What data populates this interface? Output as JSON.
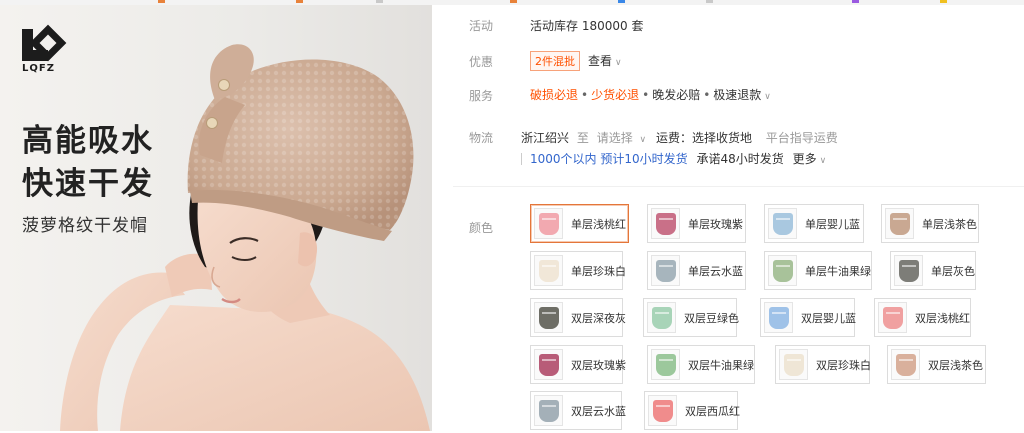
{
  "top_strip_colors": [
    "#e8823a",
    "#e8823a",
    "#c9c9c9",
    "#e8823a",
    "#3a88e8",
    "#c9c9c9",
    "#9a5ae0",
    "#f0c020"
  ],
  "hero": {
    "logo_text": "LQFZ",
    "headline_line1": "高能吸水",
    "headline_line2": "快速干发",
    "subheadline": "菠萝格纹干发帽"
  },
  "details": {
    "activity": {
      "label": "活动",
      "value": "活动库存 180000 套"
    },
    "discount": {
      "label": "优惠",
      "tag": "2件混批",
      "view": "查看"
    },
    "service": {
      "label": "服务",
      "items": [
        "破损必退",
        "少货必退",
        "晚发必赔",
        "极速退款"
      ]
    },
    "logistics": {
      "label": "物流",
      "origin": "浙江绍兴",
      "to": "至",
      "select": "请选择",
      "freight": "运费：选择收货地",
      "platform_fee": "平台指导运费",
      "quantity_note": "1000个以内 预计10小时发货",
      "promise": "承诺48小时发货",
      "more": "更多"
    },
    "color": {
      "label": "颜色",
      "options": [
        {
          "name": "单层浅桃红",
          "swatch": "#f2a9b0",
          "selected": true
        },
        {
          "name": "单层玫瑰紫",
          "swatch": "#c97088"
        },
        {
          "name": "单层婴儿蓝",
          "swatch": "#a9c8e0"
        },
        {
          "name": "单层浅茶色",
          "swatch": "#c9a892"
        },
        {
          "name": "单层珍珠白",
          "swatch": "#f1e7d8"
        },
        {
          "name": "单层云水蓝",
          "swatch": "#a7b5bd"
        },
        {
          "name": "单层牛油果绿",
          "swatch": "#a8c29a"
        },
        {
          "name": "单层灰色",
          "swatch": "#7d7d78"
        },
        {
          "name": "双层深夜灰",
          "swatch": "#6e6e66"
        },
        {
          "name": "双层豆绿色",
          "swatch": "#a8d4b8"
        },
        {
          "name": "双层婴儿蓝",
          "swatch": "#9fc2e8"
        },
        {
          "name": "双层浅桃红",
          "swatch": "#f0a0a0"
        },
        {
          "name": "双层玫瑰紫",
          "swatch": "#b85c78"
        },
        {
          "name": "双层牛油果绿",
          "swatch": "#9cc89c"
        },
        {
          "name": "双层珍珠白",
          "swatch": "#efe6d6"
        },
        {
          "name": "双层浅茶色",
          "swatch": "#d9b09c"
        },
        {
          "name": "双层云水蓝",
          "swatch": "#a4b0b8"
        },
        {
          "name": "双层西瓜红",
          "swatch": "#f08c8c"
        }
      ]
    }
  }
}
